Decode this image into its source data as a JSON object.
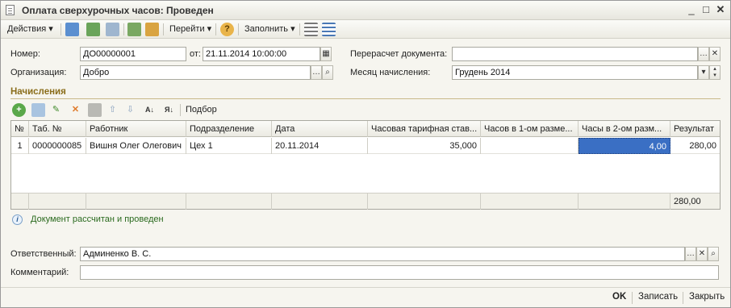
{
  "window": {
    "title": "Оплата сверхурочных часов: Проведен"
  },
  "toolbar": {
    "actions_label": "Действия",
    "goto_label": "Перейти",
    "fill_label": "Заполнить"
  },
  "form": {
    "number_label": "Номер:",
    "number_value": "ДО00000001",
    "date_label": "от:",
    "date_value": "21.11.2014 10:00:00",
    "recalc_label": "Перерасчет документа:",
    "recalc_value": "",
    "org_label": "Организация:",
    "org_value": "Добро",
    "month_label": "Месяц начисления:",
    "month_value": "Грудень 2014"
  },
  "accruals": {
    "title": "Начисления",
    "pick_label": "Подбор",
    "columns": [
      "№",
      "Таб. №",
      "Работник",
      "Подразделение",
      "Дата",
      "Часовая тарифная став...",
      "Часов в 1-ом разме...",
      "Часы в 2-ом разм...",
      "Результат"
    ],
    "rows": [
      {
        "n": "1",
        "tab": "0000000085",
        "worker": "Вишня Олег Олегович",
        "dept": "Цех 1",
        "date": "20.11.2014",
        "rate": "35,000",
        "hours1": "",
        "hours2": "4,00",
        "result": "280,00"
      }
    ],
    "total_result": "280,00"
  },
  "status": {
    "message": "Документ рассчитан и проведен"
  },
  "footer_fields": {
    "responsible_label": "Ответственный:",
    "responsible_value": "Админенко В. С.",
    "comment_label": "Комментарий:",
    "comment_value": ""
  },
  "buttons": {
    "ok": "OK",
    "save": "Записать",
    "close": "Закрыть"
  },
  "colors": {
    "section_title": "#8a6d1a",
    "selected_cell": "#3a6fc4",
    "status_text": "#2a6a1e"
  }
}
